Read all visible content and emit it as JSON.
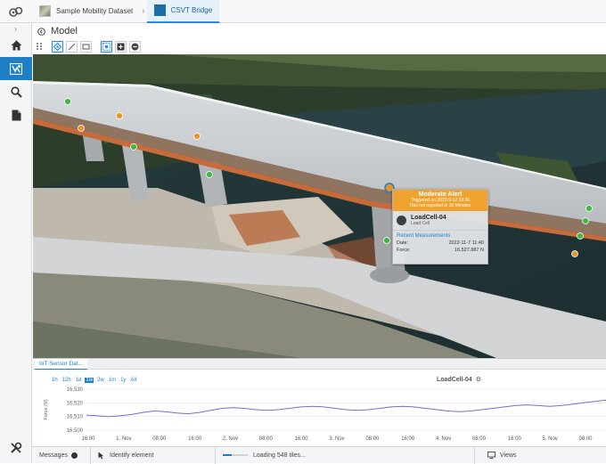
{
  "breadcrumbs": [
    {
      "label": "Sample Mobility Dataset"
    },
    {
      "label": "CSVT Bridge"
    }
  ],
  "model": {
    "title": "Model"
  },
  "alert": {
    "title": "Moderate Alert",
    "triggered": "Triggered on 2022-9-12 19:30",
    "status": "Has not reported in 30 Minutes",
    "device_name": "LoadCell-04",
    "device_type": "Load Cell",
    "section": "Recent Measurements",
    "date_label": "Date:",
    "date_value": "2022-11-7 11:40",
    "force_label": "Force:",
    "force_value": "16.527.887 N"
  },
  "panel": {
    "tab_label": "IoT Sensor Dat...",
    "ranges": [
      "1h",
      "12h",
      "1d",
      "1w",
      "2w",
      "1m",
      "1y",
      "All"
    ],
    "selected_range": "1w",
    "chart_title": "LoadCell-04",
    "chart_icon": "gear-icon"
  },
  "status": {
    "messages": "Messages",
    "identify": "Identify element",
    "loading": "Loading 548 tiles...",
    "loading_progress": 0.35,
    "views": "Views"
  },
  "colors": {
    "accent": "#1f7fc6",
    "alert": "#f0a22e",
    "sensor_ok": "#3fb83f",
    "sensor_warn": "#e8952a",
    "series": "#7b6ad8"
  },
  "chart_data": {
    "type": "line",
    "ylabel": "Force (N)",
    "ylim": [
      16500,
      16530
    ],
    "yticks": [
      16530,
      16520,
      16510,
      16500
    ],
    "xticks": [
      "16:00",
      "1. Nov",
      "08:00",
      "16:00",
      "2. Nov",
      "08:00",
      "16:00",
      "3. Nov",
      "08:00",
      "16:00",
      "4. Nov",
      "08:00",
      "16:00",
      "5. Nov",
      "08:00"
    ],
    "x": [
      0,
      0.5,
      1,
      1.5,
      2,
      2.5,
      3,
      3.5,
      4,
      4.5,
      5,
      5.5,
      6,
      6.5,
      7,
      7.5,
      8,
      8.5,
      9,
      9.5,
      10,
      10.5,
      11,
      11.5,
      12,
      12.5,
      13,
      13.5,
      14,
      14.5,
      15,
      15.5,
      16,
      16.5,
      17,
      17.5,
      18,
      18.5,
      19,
      19.5,
      20,
      20.5,
      21,
      21.5,
      22,
      22.5,
      23
    ],
    "series": [
      {
        "values": [
          16511,
          16510.5,
          16510,
          16510.5,
          16511.5,
          16513,
          16514,
          16513.5,
          16512.5,
          16512,
          16513,
          16514.5,
          16516,
          16516.5,
          16516,
          16515,
          16514.5,
          16515,
          16516,
          16517,
          16517.5,
          16517,
          16516,
          16515,
          16514.5,
          16515,
          16516,
          16517,
          16517.5,
          16517,
          16516,
          16515,
          16514,
          16513.5,
          16514,
          16515,
          16516,
          16517,
          16518,
          16518.5,
          16518,
          16517.5,
          16518,
          16519,
          16520,
          16521,
          16522
        ]
      }
    ]
  }
}
